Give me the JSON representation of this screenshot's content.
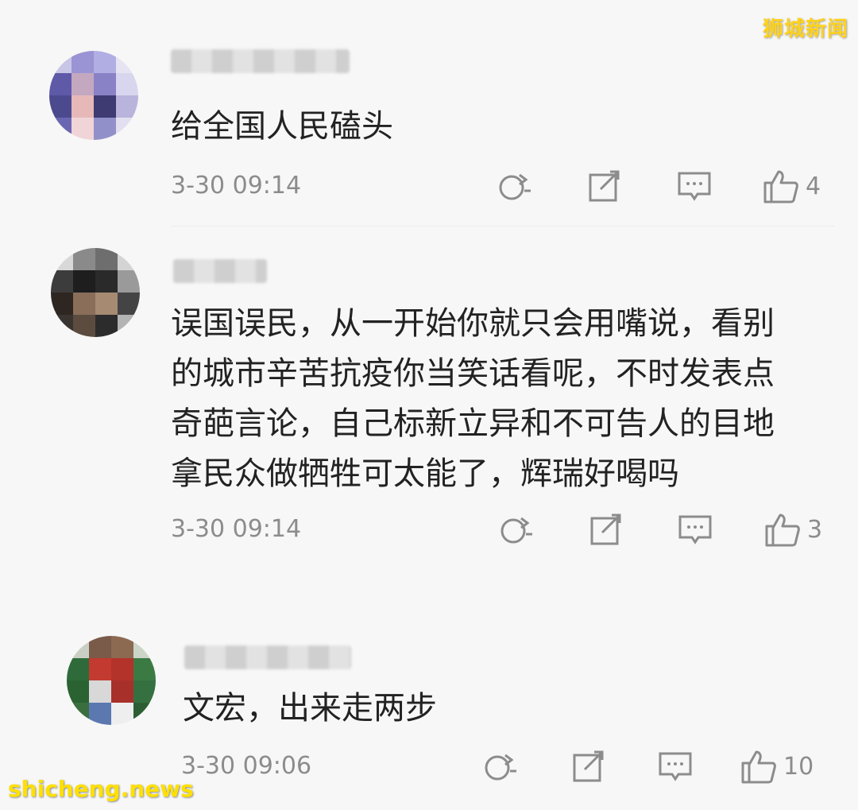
{
  "watermarks": {
    "top_right": "狮城新闻",
    "bottom_left": "shicheng.news"
  },
  "comments": [
    {
      "text": "给全国人民磕头",
      "time": "3-30 09:14",
      "likes": "4"
    },
    {
      "text_lines": [
        "误国误民，从一开始你就只会用嘴说，看别",
        "的城市辛苦抗疫你当笑话看呢，不时发表点",
        "奇葩言论，自己标新立异和不可告人的目地",
        "拿民众做牺牲可太能了，辉瑞好喝吗"
      ],
      "time": "3-30 09:14",
      "likes": "3"
    },
    {
      "text": "文宏，出来走两步",
      "time": "3-30 09:06",
      "likes": "10"
    }
  ],
  "icons": [
    "repost-icon",
    "share-icon",
    "reply-icon",
    "like-icon"
  ],
  "colors": {
    "background": "#f7f7f7",
    "text": "#222222",
    "meta": "#8c8c8c",
    "watermark": "#ffd21a"
  }
}
